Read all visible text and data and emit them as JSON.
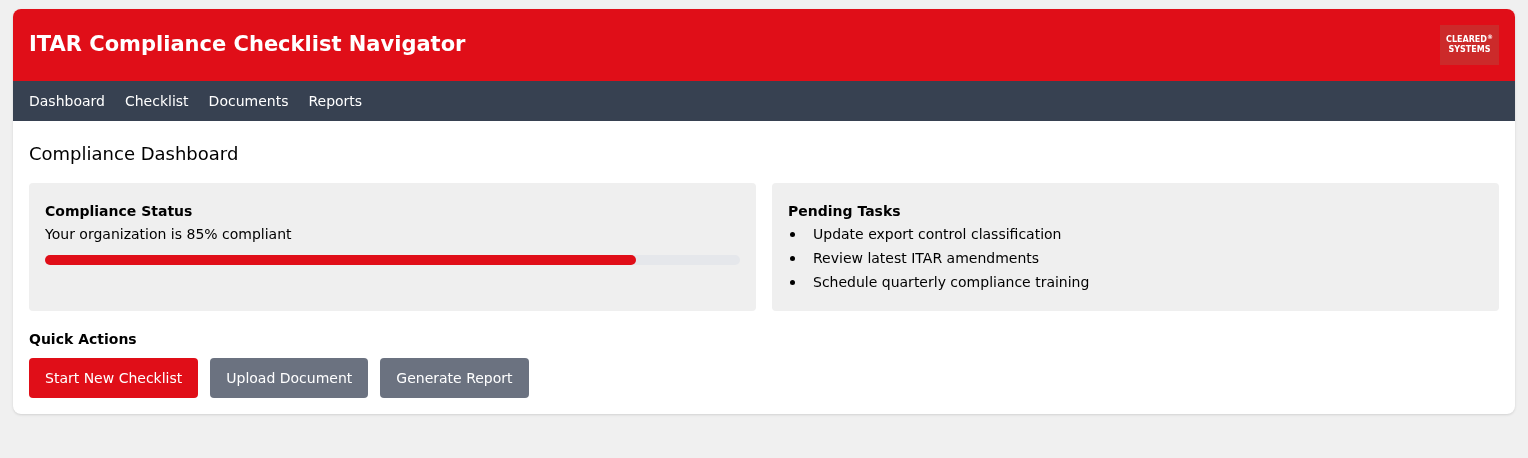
{
  "header": {
    "title": "ITAR Compliance Checklist Navigator",
    "logo_lines": [
      "CLEARED$^{®}$",
      "SYSTEMS"
    ]
  },
  "nav": [
    "Dashboard",
    "Checklist",
    "Documents",
    "Reports"
  ],
  "page_title": "Compliance Dashboard",
  "status_card": {
    "title": "Compliance Status",
    "text": "Your organization is 85% compliant",
    "level": 0.85
  },
  "tasks_card": {
    "title": "Pending Tasks",
    "items": [
      "Update export control classification",
      "Review latest ITAR amendments",
      "Schedule quarterly compliance training"
    ]
  },
  "quick_actions": {
    "title": "Quick Actions",
    "buttons": [
      {
        "label": "Start New Checklist",
        "kind": "primary"
      },
      {
        "label": "Upload Document",
        "kind": "secondary"
      },
      {
        "label": "Generate Report",
        "kind": "secondary"
      }
    ]
  }
}
